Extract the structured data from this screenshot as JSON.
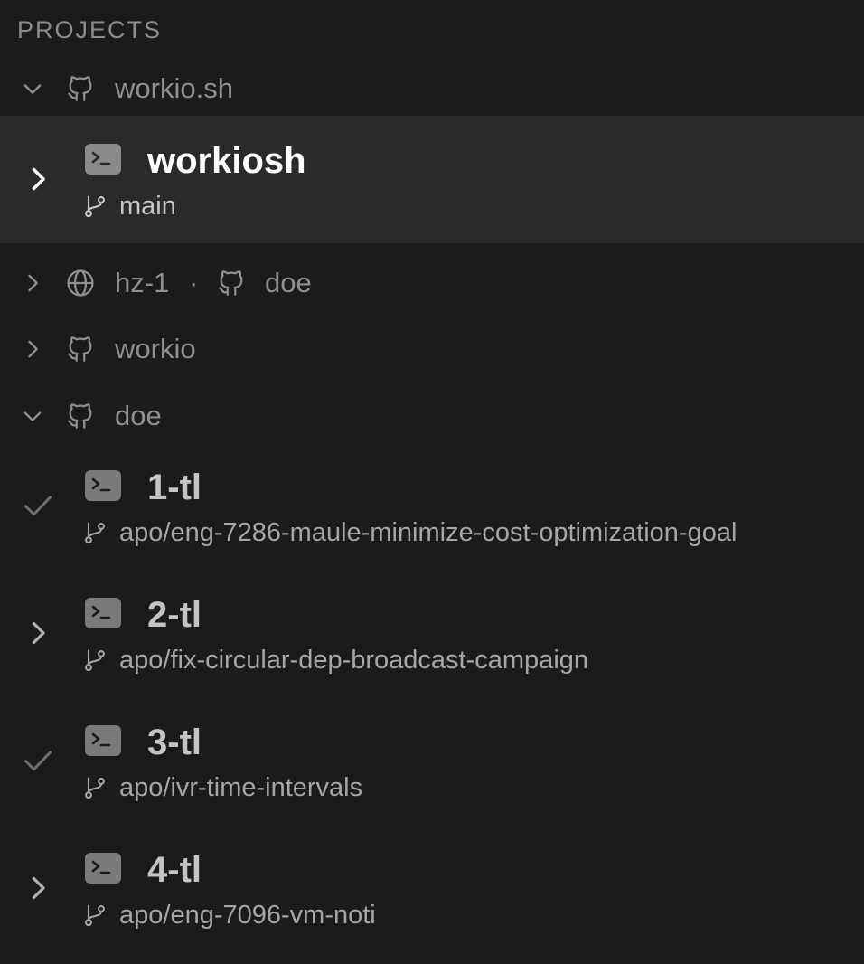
{
  "section": {
    "title": "PROJECTS"
  },
  "projects": [
    {
      "label": "workio.sh",
      "expanded": true,
      "icon": "github-icon",
      "sessions": [
        {
          "name": "workiosh",
          "branch": "main",
          "status": "chevron-right",
          "selected": true
        }
      ]
    },
    {
      "host": "hz-1",
      "separator": "·",
      "label": "doe",
      "expanded": false,
      "icon": "globe-icon"
    },
    {
      "label": "workio",
      "expanded": false,
      "icon": "github-icon"
    },
    {
      "label": "doe",
      "expanded": true,
      "icon": "github-icon",
      "sessions": [
        {
          "name": "1-tl",
          "branch": "apo/eng-7286-maule-minimize-cost-optimization-goal",
          "status": "check"
        },
        {
          "name": "2-tl",
          "branch": "apo/fix-circular-dep-broadcast-campaign",
          "status": "chevron-right"
        },
        {
          "name": "3-tl",
          "branch": "apo/ivr-time-intervals",
          "status": "check"
        },
        {
          "name": "4-tl",
          "branch": "apo/eng-7096-vm-noti",
          "status": "chevron-right"
        }
      ]
    }
  ],
  "colors": {
    "background": "#1b1b1b",
    "selected_row": "#2a2a2a",
    "muted_text": "#8f8f8f",
    "bright_text": "#ffffff",
    "terminal_icon": "#7a7a7a"
  }
}
